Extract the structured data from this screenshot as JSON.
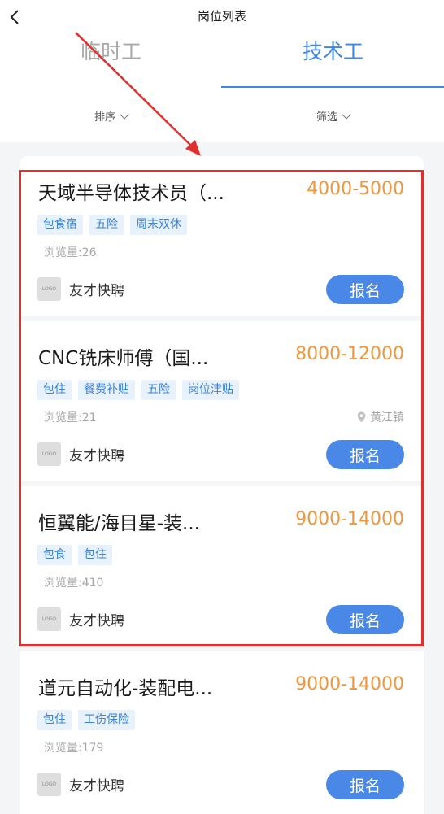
{
  "header": {
    "title": "岗位列表",
    "tabs": [
      {
        "label": "临时工",
        "active": false
      },
      {
        "label": "技术工",
        "active": true
      }
    ],
    "sort_label": "排序",
    "filter_label": "筛选"
  },
  "colors": {
    "accent": "#3f86e5",
    "salary": "#f0963d",
    "highlight": "#e0302e",
    "tag_bg": "#e8f2fd"
  },
  "jobs": [
    {
      "title": "天域半导体技术员（...",
      "salary": "4000-5000",
      "tags": [
        "包食宿",
        "五险",
        "周末双休"
      ],
      "views": "浏览量:26",
      "location": "",
      "logo_text": "LOGO",
      "company": "友才快聘",
      "apply_label": "报名"
    },
    {
      "title": "CNC铣床师傅（国...",
      "salary": "8000-12000",
      "tags": [
        "包住",
        "餐费补贴",
        "五险",
        "岗位津贴"
      ],
      "views": "浏览量:21",
      "location": "黄江镇",
      "logo_text": "LOGO",
      "company": "友才快聘",
      "apply_label": "报名"
    },
    {
      "title": "恒翼能/海目星-装...",
      "salary": "9000-14000",
      "tags": [
        "包食",
        "包住"
      ],
      "views": "浏览量:410",
      "location": "",
      "logo_text": "LOGO",
      "company": "友才快聘",
      "apply_label": "报名"
    },
    {
      "title": "道元自动化-装配电...",
      "salary": "9000-14000",
      "tags": [
        "包住",
        "工伤保险"
      ],
      "views": "浏览量:179",
      "location": "",
      "logo_text": "LOGO",
      "company": "友才快聘",
      "apply_label": "报名"
    }
  ]
}
